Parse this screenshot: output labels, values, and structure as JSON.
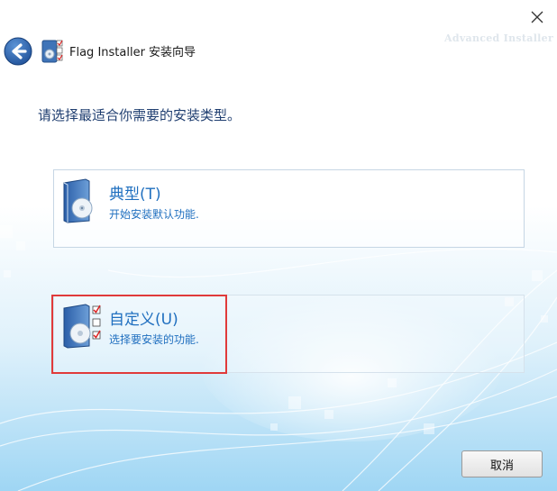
{
  "window": {
    "title": "Flag Installer 安装向导",
    "brand": "Advanced Installer"
  },
  "prompt": "请选择最适合你需要的安装类型。",
  "options": [
    {
      "title": "典型(T)",
      "description": "开始安装默认功能.",
      "icon": "cd-box-icon"
    },
    {
      "title": "自定义(U)",
      "description": "选择要安装的功能.",
      "icon": "cd-box-checklist-icon"
    }
  ],
  "buttons": {
    "cancel": "取消"
  },
  "colors": {
    "accent": "#1f6fbf",
    "highlight": "#e03a3a",
    "prompt": "#1f3e70"
  }
}
